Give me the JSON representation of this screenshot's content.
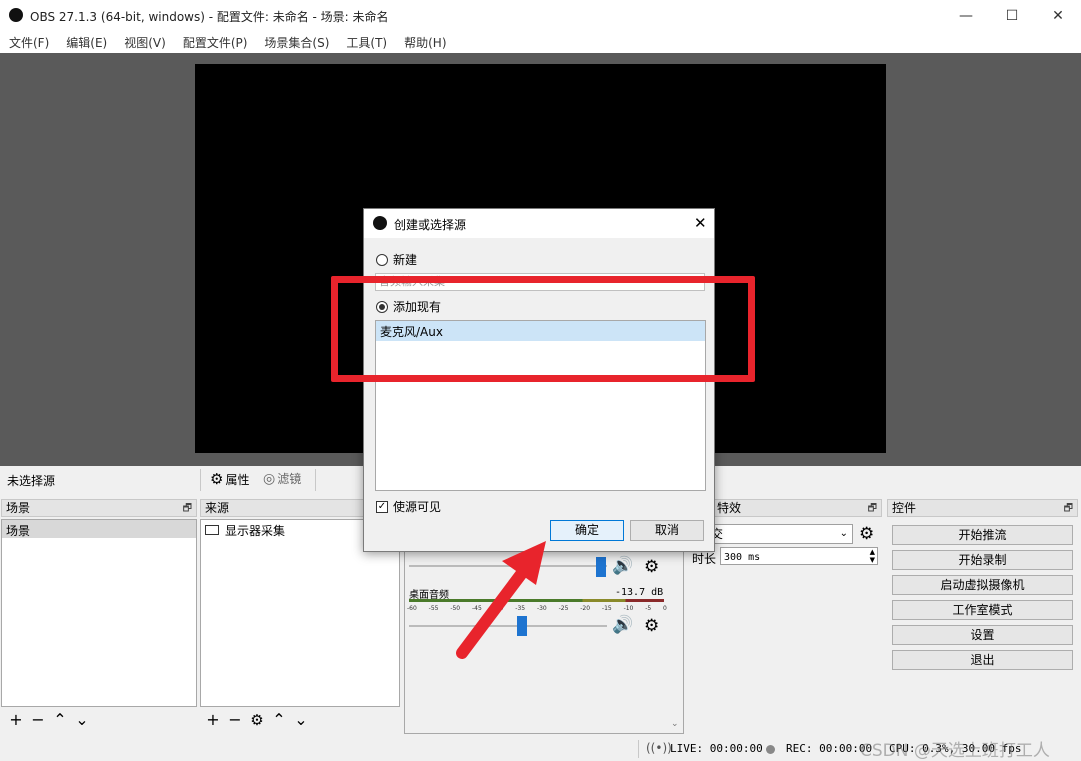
{
  "window": {
    "title": "OBS 27.1.3 (64-bit, windows) - 配置文件: 未命名 - 场景: 未命名",
    "min": "—",
    "max": "☐",
    "close": "✕"
  },
  "menu": [
    "文件(F)",
    "编辑(E)",
    "视图(V)",
    "配置文件(P)",
    "场景集合(S)",
    "工具(T)",
    "帮助(H)"
  ],
  "source_toolbar": {
    "no_source": "未选择源",
    "properties": "属性",
    "filters": "滤镜"
  },
  "scenes": {
    "title": "场景",
    "items": [
      "场景"
    ]
  },
  "sources": {
    "title": "来源",
    "items": [
      "显示器采集"
    ]
  },
  "mixer": {
    "desktop_label": "桌面音频",
    "desktop_db": "-13.7 dB",
    "ticks": [
      "-60",
      "-55",
      "-50",
      "-45",
      "-40",
      "-35",
      "-30",
      "-25",
      "-20",
      "-15",
      "-10",
      "-5",
      "0"
    ]
  },
  "transitions": {
    "title": "特效",
    "selected": "交",
    "duration_label": "时长",
    "duration_value": "300 ms"
  },
  "controls": {
    "title": "控件",
    "buttons": [
      "开始推流",
      "开始录制",
      "启动虚拟摄像机",
      "工作室模式",
      "设置",
      "退出"
    ]
  },
  "status": {
    "live": "LIVE: 00:00:00",
    "rec": "REC: 00:00:00",
    "cpu": "CPU: 0.3%, 30.00 fps",
    "watermark": "CSDN @天选上班打工人"
  },
  "dialog": {
    "title": "创建或选择源",
    "new_label": "新建",
    "new_placeholder": "音频输入采集",
    "existing_label": "添加现有",
    "existing_items": [
      "麦克风/Aux"
    ],
    "visible_label": "使源可见",
    "ok": "确定",
    "cancel": "取消"
  },
  "colors": {
    "highlight_box": "#e8242c",
    "arrow": "#e8242c",
    "selected_row": "#cce4f7",
    "slider": "#1e74d0"
  }
}
